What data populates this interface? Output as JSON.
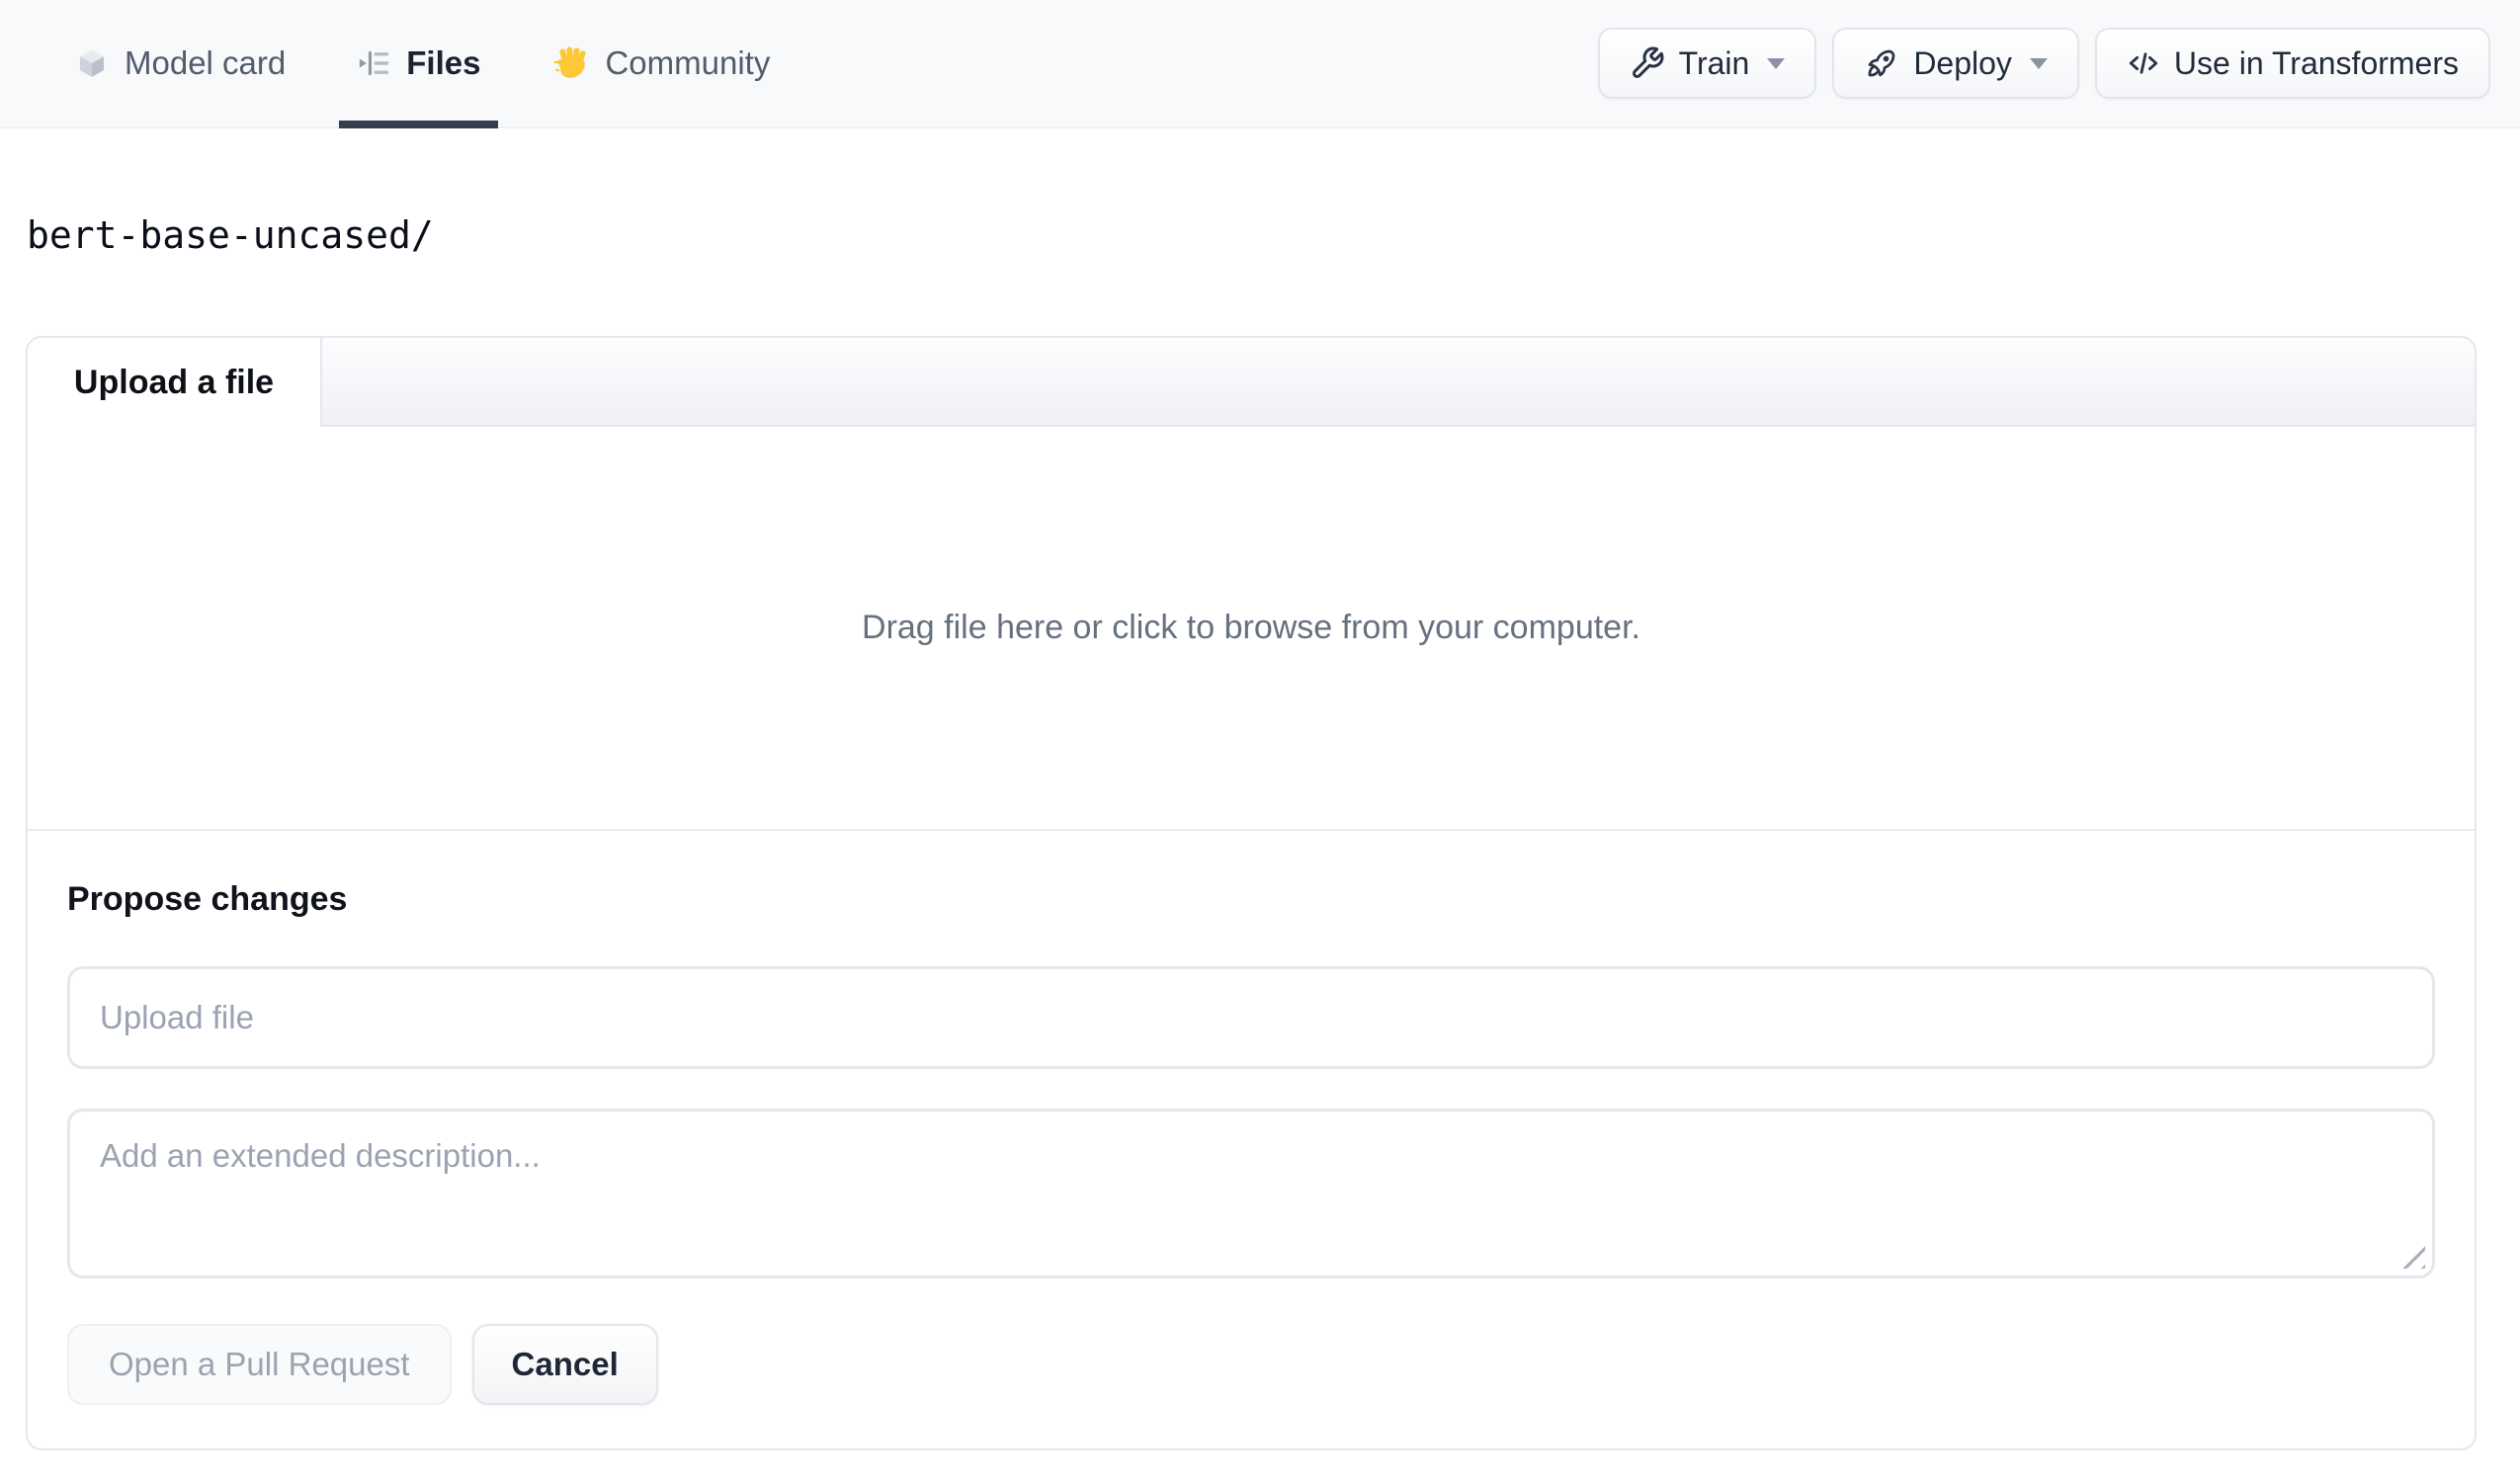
{
  "nav": {
    "tabs": [
      {
        "label": "Model card",
        "icon": "cube-icon",
        "active": false
      },
      {
        "label": "Files",
        "icon": "files-icon",
        "active": true
      },
      {
        "label": "Community",
        "icon": "wave-icon",
        "active": false
      }
    ],
    "actions": [
      {
        "label": "Train",
        "icon": "wrench-icon",
        "has_dropdown": true
      },
      {
        "label": "Deploy",
        "icon": "rocket-icon",
        "has_dropdown": true
      },
      {
        "label": "Use in Transformers",
        "icon": "code-icon",
        "has_dropdown": false
      }
    ]
  },
  "breadcrumb": {
    "path": "bert-base-uncased/"
  },
  "upload_card": {
    "tab_label": "Upload a file",
    "dropzone_text": "Drag file here or click to browse from your computer.",
    "propose_heading": "Propose changes",
    "filename_placeholder": "Upload file",
    "description_placeholder": "Add an extended description...",
    "submit_label": "Open a Pull Request",
    "cancel_label": "Cancel"
  },
  "colors": {
    "nav_bg": "#f8f9fb",
    "active_tab_underline": "#363e4e",
    "active_tab_text": "#1b2330",
    "inactive_tab_text": "#515c6c",
    "dropzone_text": "#66707f",
    "placeholder_text": "#9aa3b2",
    "card_border": "#e4e7ec",
    "wave_hand": "#fdc835"
  }
}
